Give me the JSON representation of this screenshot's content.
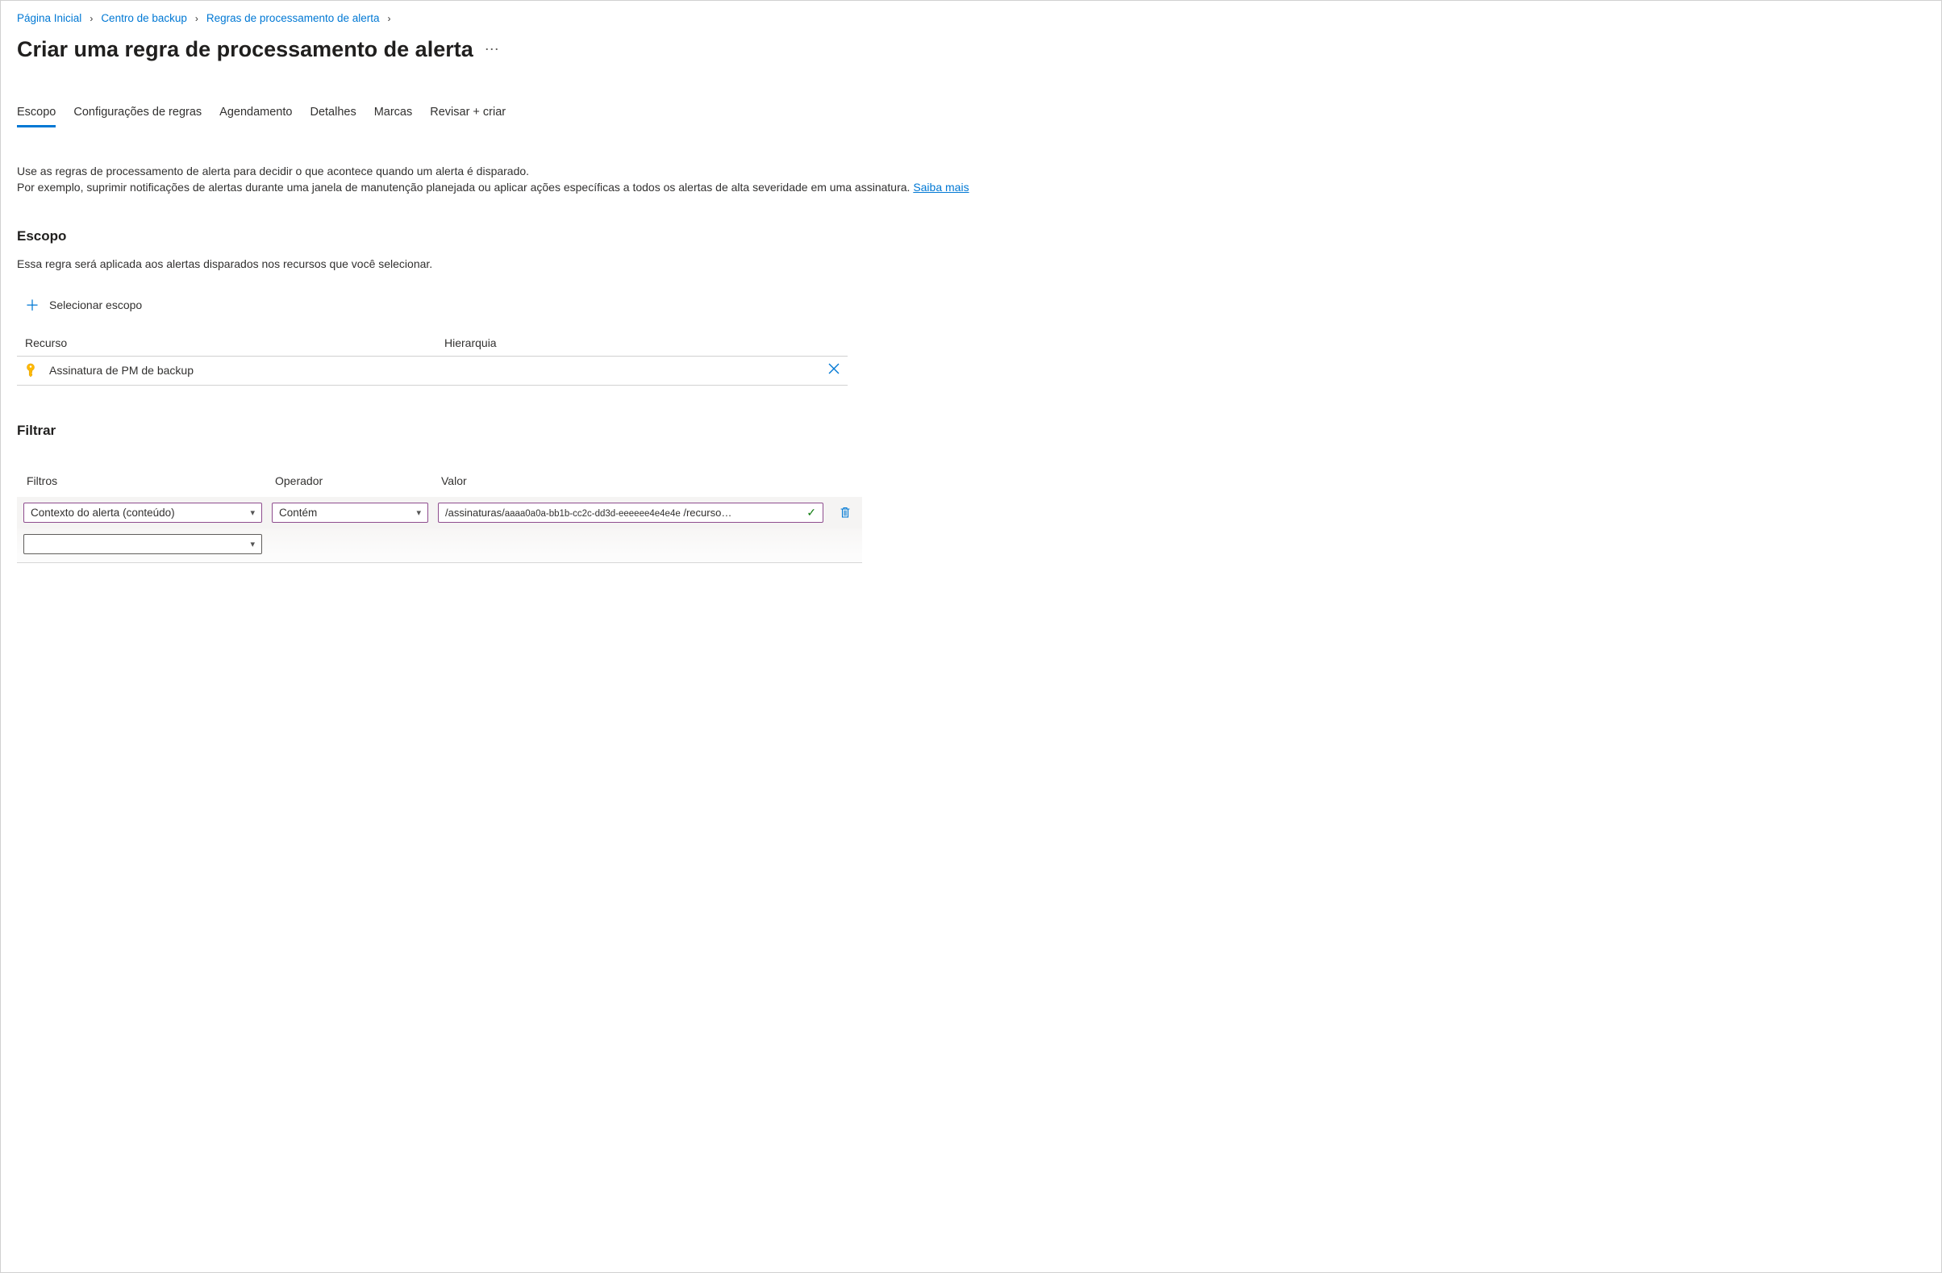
{
  "breadcrumbs": {
    "items": [
      "Página Inicial",
      "Centro de backup",
      "Regras de processamento de alerta"
    ]
  },
  "page": {
    "title": "Criar uma regra de processamento de alerta"
  },
  "tabs": {
    "items": [
      {
        "label": "Escopo",
        "active": true
      },
      {
        "label": "Configurações de regras",
        "active": false
      },
      {
        "label": "Agendamento",
        "active": false
      },
      {
        "label": "Detalhes",
        "active": false
      },
      {
        "label": "Marcas",
        "active": false
      },
      {
        "label": "Revisar + criar",
        "active": false
      }
    ]
  },
  "description": {
    "line1": "Use as regras de processamento de alerta para decidir o que acontece quando um alerta é disparado.",
    "line2_a": "Por exemplo, suprimir notificações de alertas durante uma janela de manutenção planejada ou aplicar ações específicas a todos os alertas de alta severidade em uma assinatura. ",
    "learn_more": "Saiba mais"
  },
  "scope": {
    "heading": "Escopo",
    "subtext": "Essa regra será aplicada aos alertas disparados nos recursos que você selecionar.",
    "select_button": "Selecionar escopo",
    "columns": {
      "resource": "Recurso",
      "hierarchy": "Hierarquia"
    },
    "rows": [
      {
        "name": "Assinatura de PM de backup",
        "hierarchy": ""
      }
    ]
  },
  "filter": {
    "heading": "Filtrar",
    "columns": {
      "filters": "Filtros",
      "operator": "Operador",
      "value": "Valor"
    },
    "rows": [
      {
        "filter_field": "Contexto do alerta (conteúdo)",
        "operator": "Contém",
        "value_prefix": "/assinaturas/",
        "value_id": "aaaa0a0a-bb1b-cc2c-dd3d-eeeeee4e4e4e",
        "value_suffix": " /recurso…"
      }
    ],
    "empty_filter": ""
  }
}
